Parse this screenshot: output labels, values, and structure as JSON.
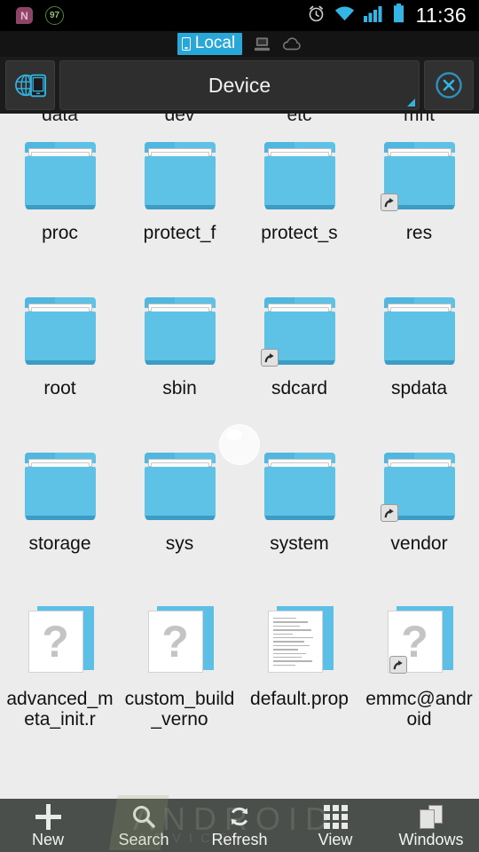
{
  "statusbar": {
    "icons": [
      {
        "name": "nova-badge-icon",
        "label": "N"
      },
      {
        "name": "battery-percent-icon",
        "label": "97"
      }
    ],
    "alarm_icon": "alarm-clock-icon",
    "wifi_icon": "wifi-icon",
    "signal_icon": "cellular-signal-icon",
    "battery_icon": "battery-icon",
    "time": "11:36",
    "accent_color": "#33b5e5"
  },
  "tabstrip": {
    "tabs": [
      {
        "label": "Local",
        "icon": "phone-icon",
        "active": true
      },
      {
        "label": "",
        "icon": "computer-icon",
        "active": false
      },
      {
        "label": "",
        "icon": "cloud-icon",
        "active": false
      }
    ],
    "active_bg": "#27a8d8"
  },
  "header": {
    "left_icon": "globe-device-icon",
    "title": "Device",
    "close_icon": "close-circle-icon",
    "corner_icon": "resize-corner-icon",
    "accent_color": "#34b3e0"
  },
  "grid": {
    "clipped_top_row": [
      "data",
      "dev",
      "etc",
      "mnt"
    ],
    "items": [
      {
        "label": "proc",
        "type": "folder",
        "shortcut": false
      },
      {
        "label": "protect_f",
        "type": "folder",
        "shortcut": false
      },
      {
        "label": "protect_s",
        "type": "folder",
        "shortcut": false
      },
      {
        "label": "res",
        "type": "folder",
        "shortcut": true
      },
      {
        "label": "root",
        "type": "folder",
        "shortcut": false
      },
      {
        "label": "sbin",
        "type": "folder",
        "shortcut": false
      },
      {
        "label": "sdcard",
        "type": "folder",
        "shortcut": true
      },
      {
        "label": "spdata",
        "type": "folder",
        "shortcut": false
      },
      {
        "label": "storage",
        "type": "folder",
        "shortcut": false
      },
      {
        "label": "sys",
        "type": "folder",
        "shortcut": false
      },
      {
        "label": "system",
        "type": "folder",
        "shortcut": false
      },
      {
        "label": "vendor",
        "type": "folder",
        "shortcut": true
      },
      {
        "label": "advanced_meta_init.r",
        "type": "unknown-file",
        "shortcut": false
      },
      {
        "label": "custom_build_verno",
        "type": "unknown-file",
        "shortcut": false
      },
      {
        "label": "default.prop",
        "type": "text-file",
        "shortcut": false
      },
      {
        "label": "emmc@android",
        "type": "unknown-file",
        "shortcut": true
      }
    ],
    "folder_color": "#5ec1e6",
    "background": "#ECECEC"
  },
  "toolbar": {
    "items": [
      {
        "label": "New",
        "icon": "plus-icon"
      },
      {
        "label": "Search",
        "icon": "search-icon"
      },
      {
        "label": "Refresh",
        "icon": "refresh-icon"
      },
      {
        "label": "View",
        "icon": "grid-view-icon"
      },
      {
        "label": "Windows",
        "icon": "windows-icon"
      }
    ],
    "background": "#4b4f4b"
  },
  "watermark": {
    "line1": "ANDROID",
    "line2": "ADVICE"
  }
}
